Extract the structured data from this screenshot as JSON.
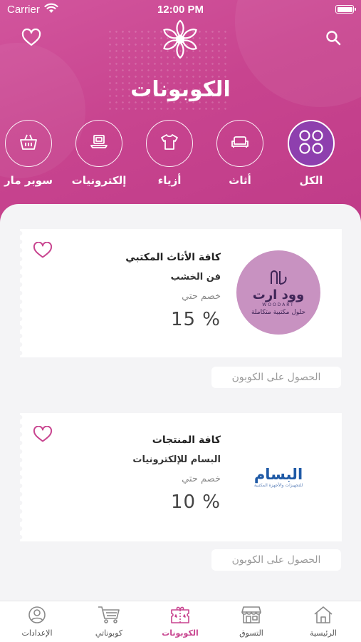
{
  "status_bar": {
    "carrier": "Carrier",
    "time": "12:00 PM"
  },
  "header": {
    "title": "الكوبونات"
  },
  "categories": [
    {
      "label": "الكل",
      "icon": "grid-icon",
      "active": true
    },
    {
      "label": "أثاث",
      "icon": "sofa-icon",
      "active": false
    },
    {
      "label": "أزياء",
      "icon": "shirt-icon",
      "active": false
    },
    {
      "label": "إلكترونيات",
      "icon": "laptop-icon",
      "active": false
    },
    {
      "label": "سوبر مار",
      "icon": "basket-icon",
      "active": false
    }
  ],
  "coupons": [
    {
      "name": "كافة الأثاث المكتبي",
      "store": "فن الخشب",
      "discount_label": "خصم حتي",
      "discount": "15 %",
      "logo": {
        "main": "وود ارت",
        "sub_latin": "WOODART",
        "tagline": "حلول مكتبية متكاملة",
        "color": "#c892c1"
      },
      "button": "الحصول على الكوبون"
    },
    {
      "name": "كافة المنتجات",
      "store": "البسام للإلكترونيات",
      "discount_label": "خصم حتي",
      "discount": "10 %",
      "logo": {
        "main": "البسام",
        "tagline": "للتجهيزات والأجهزة المكتبية",
        "color": "#1f5aa6"
      },
      "button": "الحصول على الكوبون"
    }
  ],
  "tabbar": [
    {
      "label": "الإعدادات",
      "icon": "user-icon",
      "active": false
    },
    {
      "label": "كوبوناتي",
      "icon": "cart-icon",
      "active": false
    },
    {
      "label": "الكوبونات",
      "icon": "coupon-icon",
      "active": true
    },
    {
      "label": "التسوق",
      "icon": "store-icon",
      "active": false
    },
    {
      "label": "الرئيسية",
      "icon": "home-icon",
      "active": false
    }
  ],
  "colors": {
    "brand": "#c8448f",
    "active_category": "#8e3fae",
    "background": "#f4f4f6"
  }
}
